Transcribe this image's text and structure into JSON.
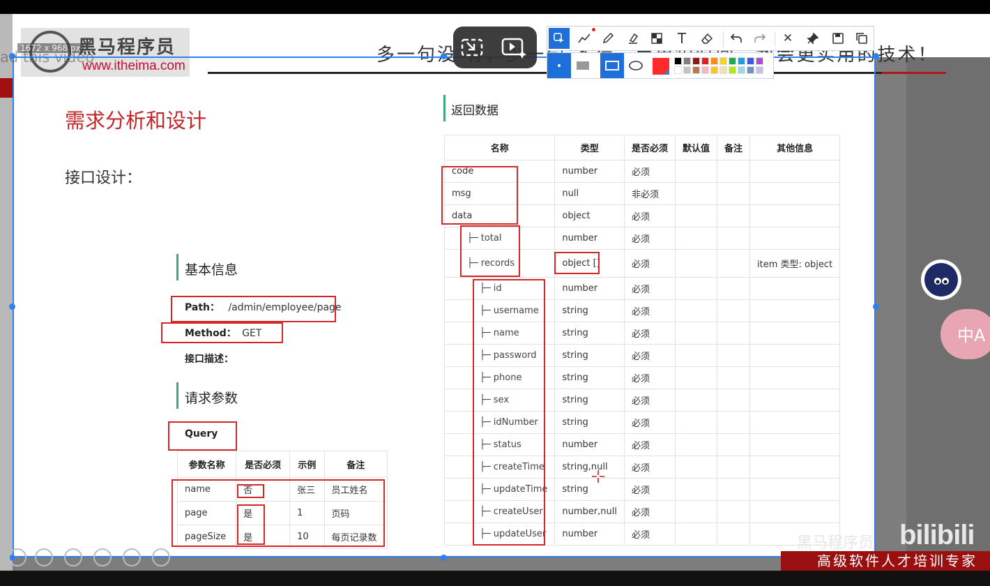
{
  "window": {
    "dims_label": "1672 x 968  px",
    "ghost_text": "ad this video"
  },
  "logo": {
    "name": "黑马程序员",
    "url": "www.itheima.com"
  },
  "slogan": "多一句没 有，少一句 不行，用更短时间，教会更实用的技术！",
  "slide": {
    "title": "需求分析和设计",
    "subtitle": "接口设计：",
    "basic_info_heading": "基本信息",
    "path_label": "Path：",
    "path_value": "/admin/employee/page",
    "method_label": "Method：",
    "method_value": "GET",
    "desc_label": "接口描述：",
    "request_heading": "请求参数",
    "query_label": "Query",
    "query_headers": [
      "参数名称",
      "是否必须",
      "示例",
      "备注"
    ],
    "query_rows": [
      [
        "name",
        "否",
        "张三",
        "员工姓名"
      ],
      [
        "page",
        "是",
        "1",
        "页码"
      ],
      [
        "pageSize",
        "是",
        "10",
        "每页记录数"
      ]
    ],
    "response_heading": "返回数据",
    "response_headers": [
      "名称",
      "类型",
      "是否必须",
      "默认值",
      "备注",
      "其他信息"
    ],
    "response_rows": [
      [
        "code",
        "number",
        "必须",
        "",
        "",
        ""
      ],
      [
        "msg",
        "null",
        "非必须",
        "",
        "",
        ""
      ],
      [
        "data",
        "object",
        "必须",
        "",
        "",
        ""
      ],
      [
        "├─ total",
        "number",
        "必须",
        "",
        "",
        ""
      ],
      [
        "├─ records",
        "object []",
        "必须",
        "",
        "",
        "item 类型: object"
      ],
      [
        "├─ id",
        "number",
        "必须",
        "",
        "",
        ""
      ],
      [
        "├─ username",
        "string",
        "必须",
        "",
        "",
        ""
      ],
      [
        "├─ name",
        "string",
        "必须",
        "",
        "",
        ""
      ],
      [
        "├─ password",
        "string",
        "必须",
        "",
        "",
        ""
      ],
      [
        "├─ phone",
        "string",
        "必须",
        "",
        "",
        ""
      ],
      [
        "├─ sex",
        "string",
        "必须",
        "",
        "",
        ""
      ],
      [
        "├─ idNumber",
        "string",
        "必须",
        "",
        "",
        ""
      ],
      [
        "├─ status",
        "number",
        "必须",
        "",
        "",
        ""
      ],
      [
        "├─ createTime",
        "string,null",
        "必须",
        "",
        "",
        ""
      ],
      [
        "├─ updateTime",
        "string",
        "必须",
        "",
        "",
        ""
      ],
      [
        "├─ createUser",
        "number,null",
        "必须",
        "",
        "",
        ""
      ],
      [
        "├─ updateUser",
        "number",
        "必须",
        "",
        "",
        ""
      ]
    ]
  },
  "toolbar": {
    "tools": [
      "select-icon",
      "line-icon",
      "pen-icon",
      "highlighter-icon",
      "mosaic-icon",
      "text-icon",
      "eraser-icon",
      "undo-icon",
      "redo-icon",
      "close-icon",
      "pin-icon",
      "save-icon",
      "copy-icon"
    ],
    "text_tool_glyph": "T",
    "close_glyph": "✕",
    "accent": "#1e6fd9",
    "current_color": "#ff2a2a",
    "palette_row1": [
      "#000000",
      "#7f7f7f",
      "#8b1a1a",
      "#e02020",
      "#f28c1c",
      "#f7d21e",
      "#26a65b",
      "#1aa2e0",
      "#3b5bdb",
      "#b04ad6"
    ],
    "palette_row2": [
      "#ffffff",
      "#c3c3c3",
      "#b5765a",
      "#f5b7c8",
      "#f8c234",
      "#efe4b0",
      "#b5e61d",
      "#99d9ea",
      "#7092be",
      "#c8bfe7"
    ]
  },
  "side": {
    "translate_label": "中A"
  },
  "watermark": {
    "brand": "黑马程序员",
    "bili": "bilibili",
    "tagline": "高级软件人才培训专家"
  },
  "colors": {
    "selection": "#2f80ed",
    "red_box": "#d42626",
    "title_red": "#c0282a",
    "section_green": "#3aa87a"
  }
}
